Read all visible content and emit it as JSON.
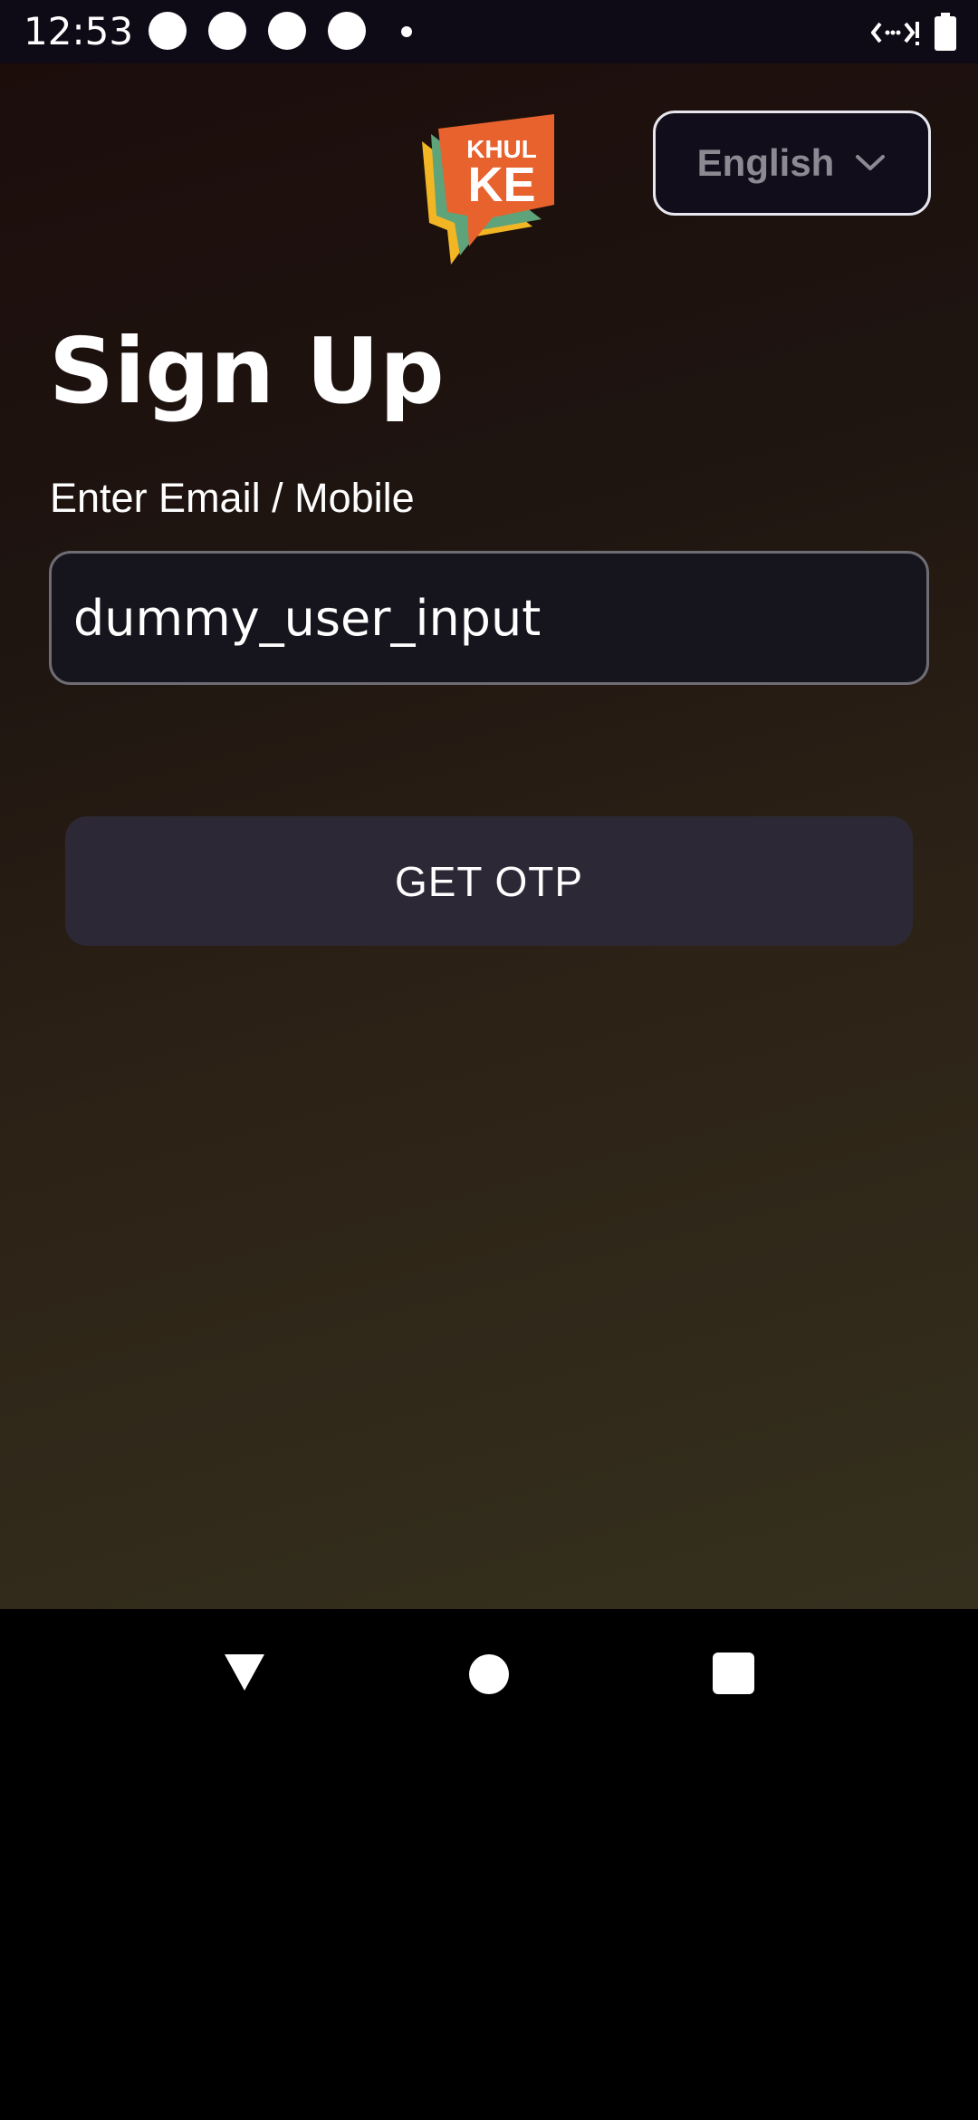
{
  "status_bar": {
    "time": "12:53",
    "notification_icons": [
      "notification-dot",
      "notification-dot",
      "notification-dot",
      "notification-dot"
    ],
    "indicator_icon": "small-dot",
    "network_icon": "data-saver-icon",
    "battery_icon": "battery-icon"
  },
  "header": {
    "logo_text_top": "KHUL",
    "logo_text_bottom": "KE",
    "language_selector": {
      "label": "English",
      "icon": "chevron-down-icon"
    }
  },
  "form": {
    "title": "Sign Up",
    "field_label": "Enter Email / Mobile",
    "field_value": "dummy_user_input",
    "submit_label": "GET OTP"
  },
  "nav_bar": {
    "back_icon": "back-triangle-icon",
    "home_icon": "home-circle-icon",
    "recents_icon": "recents-square-icon"
  },
  "colors": {
    "logo_orange": "#e8622e",
    "logo_green": "#5fa37a",
    "logo_yellow": "#f2b624",
    "button_bg": "#2d2836",
    "input_bg": "#16141c"
  }
}
